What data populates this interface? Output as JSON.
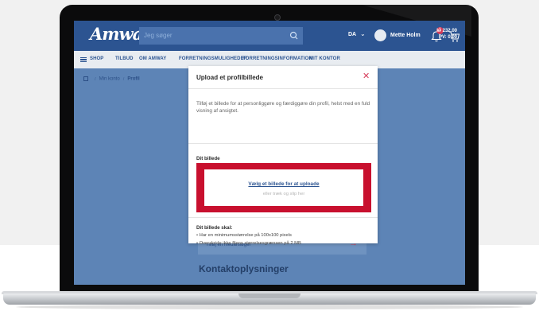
{
  "header": {
    "logo": "Amway",
    "search_placeholder": "Jeg søger",
    "language": "DA",
    "user_name": "Mette Holm",
    "notification_count": "1",
    "cart_price": "kr 232,00",
    "cart_pv": "PV: 0,00"
  },
  "nav": {
    "items": [
      "SHOP",
      "TILBUD",
      "OM AMWAY",
      "FORRETNINGSMULIGHEDER",
      "FORRETNINGSINFORMATION",
      "MIT KONTOR"
    ]
  },
  "breadcrumb": {
    "items": [
      "Min konto",
      "Profil"
    ]
  },
  "background": {
    "add_cosigner": "Tilføj en medansøger",
    "section_heading": "Kontaktoplysninger"
  },
  "modal": {
    "title": "Upload et profilbillede",
    "description": "Tilføj et billede for at personliggøre og færdiggøre din profil, helst med en fuld visning af ansigtet.",
    "image_label": "Dit billede",
    "upload_link": "Vælg et billede for at uploade",
    "upload_hint": "eller træk og slip her",
    "requirements_title": "Dit billede skal:",
    "requirements": [
      "Har en minimumsstørrelse på 100x100 pixels",
      "Overskride ikke filens størrelsesgrænsen på 2 MB"
    ]
  },
  "colors": {
    "brand_blue": "#2c5491",
    "overlay_blue": "#5d84b6",
    "highlight_red": "#c8102e",
    "close_red": "#d63c5a"
  }
}
